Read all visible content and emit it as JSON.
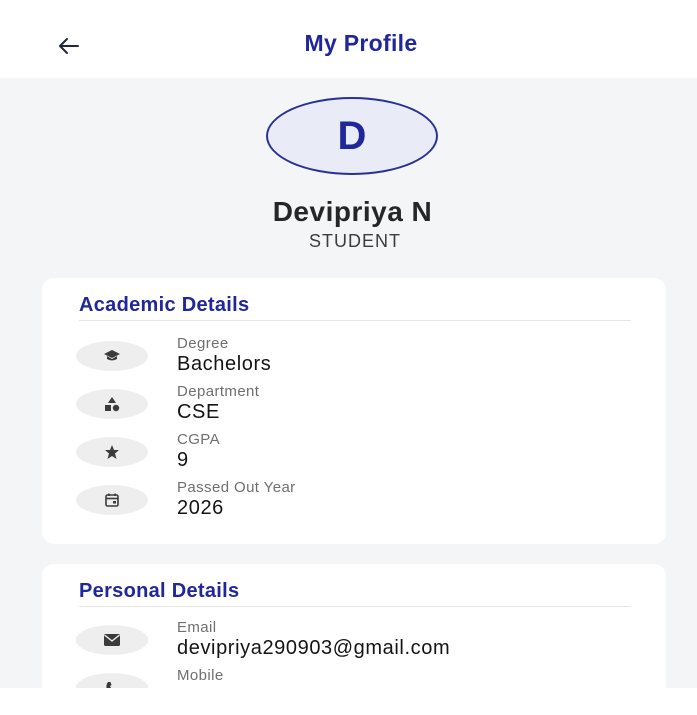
{
  "header": {
    "title": "My Profile",
    "back_icon": "arrow-left-icon"
  },
  "profile": {
    "avatar_letter": "D",
    "name": "Devipriya N",
    "role": "STUDENT"
  },
  "academic": {
    "title": "Academic Details",
    "items": [
      {
        "icon": "graduation-cap-icon",
        "label": "Degree",
        "value": "Bachelors"
      },
      {
        "icon": "category-shapes-icon",
        "label": "Department",
        "value": "CSE"
      },
      {
        "icon": "star-icon",
        "label": "CGPA",
        "value": "9"
      },
      {
        "icon": "calendar-icon",
        "label": "Passed Out Year",
        "value": "2026"
      }
    ]
  },
  "personal": {
    "title": "Personal Details",
    "items": [
      {
        "icon": "mail-icon",
        "label": "Email",
        "value": "devipriya290903@gmail.com"
      },
      {
        "icon": "phone-icon",
        "label": "Mobile",
        "value": ""
      }
    ]
  },
  "colors": {
    "brand": "#20279a",
    "background": "#f4f5f7",
    "card": "#ffffff"
  }
}
